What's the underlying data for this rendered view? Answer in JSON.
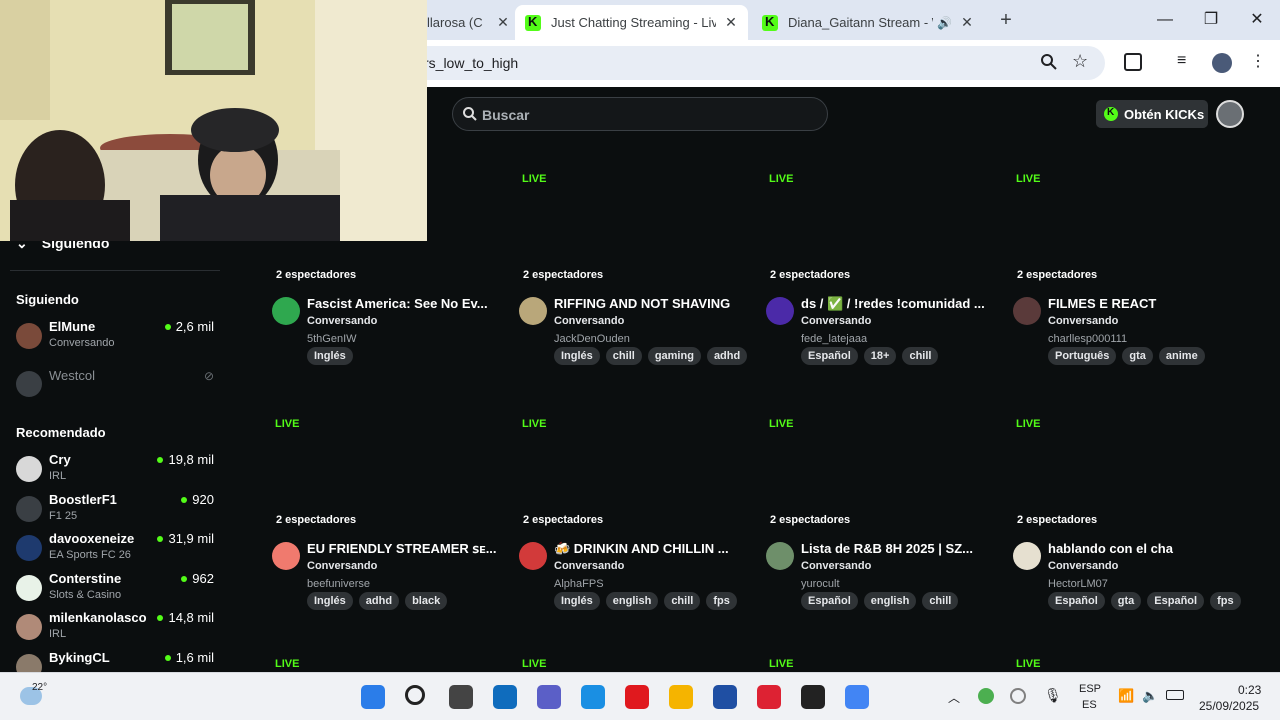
{
  "browser": {
    "tabs": [
      {
        "title": "llarosa (C",
        "active": false
      },
      {
        "title": "Just Chatting Streaming - Live S",
        "active": true
      },
      {
        "title": "Diana_Gaitann Stream - Wa",
        "active": false
      }
    ],
    "url": "rs_low_to_high",
    "new_tab_label": "+",
    "window_controls": {
      "minimize": "—",
      "restore": "❐",
      "close": "✕"
    }
  },
  "header": {
    "search_placeholder": "Buscar",
    "kicks_button": "Obtén KICKs"
  },
  "sidebar": {
    "following_toggle": "Siguiendo",
    "following_title": "Siguiendo",
    "following": [
      {
        "name": "ElMune",
        "category": "Conversando",
        "viewers": "2,6 mil",
        "live": true
      },
      {
        "name": "Westcol",
        "category": "",
        "viewers": "",
        "live": false
      }
    ],
    "recommended_title": "Recomendado",
    "recommended": [
      {
        "name": "Cry",
        "category": "IRL",
        "viewers": "19,8 mil"
      },
      {
        "name": "BoostlerF1",
        "category": "F1 25",
        "viewers": "920"
      },
      {
        "name": "davooxeneize",
        "category": "EA Sports FC 26",
        "viewers": "31,9 mil"
      },
      {
        "name": "Conterstine",
        "category": "Slots & Casino",
        "viewers": "962"
      },
      {
        "name": "milenkanolasco",
        "category": "IRL",
        "viewers": "14,8 mil"
      },
      {
        "name": "BykingCL",
        "category": "",
        "viewers": "1,6 mil"
      }
    ]
  },
  "live_label": "LIVE",
  "streams": [
    {
      "viewers": "2 espectadores",
      "title": "Fascist America: See No Ev...",
      "category": "Conversando",
      "user": "5thGenIW",
      "tags": [
        "Inglés"
      ],
      "avatar_color": "#2fa84f"
    },
    {
      "viewers": "2 espectadores",
      "title": "RIFFING AND NOT SHAVING",
      "category": "Conversando",
      "user": "JackDenOuden",
      "tags": [
        "Inglés",
        "chill",
        "gaming",
        "adhd"
      ],
      "avatar_color": "#b9a77a"
    },
    {
      "viewers": "2 espectadores",
      "title": "ds / ✅ / !redes !comunidad ...",
      "category": "Conversando",
      "user": "fede_latejaaa",
      "tags": [
        "Español",
        "18+",
        "chill"
      ],
      "avatar_color": "#4b2aa8"
    },
    {
      "viewers": "2 espectadores",
      "title": "FILMES E REACT",
      "category": "Conversando",
      "user": "charllesp000111",
      "tags": [
        "Português",
        "gta",
        "anime"
      ],
      "avatar_color": "#5a3a3a"
    },
    {
      "viewers": "2 espectadores",
      "title": "EU FRIENDLY STREAMER ꜱᴇ...",
      "category": "Conversando",
      "user": "beefuniverse",
      "tags": [
        "Inglés",
        "adhd",
        "black"
      ],
      "avatar_color": "#f07a6e"
    },
    {
      "viewers": "2 espectadores",
      "title": "🍻 DRINKIN AND CHILLIN ...",
      "category": "Conversando",
      "user": "AlphaFPS",
      "tags": [
        "Inglés",
        "english",
        "chill",
        "fps"
      ],
      "avatar_color": "#d23a3a"
    },
    {
      "viewers": "2 espectadores",
      "title": "Lista de R&B 8H 2025 | SZ...",
      "category": "Conversando",
      "user": "yurocult",
      "tags": [
        "Español",
        "english",
        "chill"
      ],
      "avatar_color": "#6e8f6a"
    },
    {
      "viewers": "2 espectadores",
      "title": "hablando con el cha",
      "category": "Conversando",
      "user": "HectorLM07",
      "tags": [
        "Español",
        "gta",
        "Español",
        "fps"
      ],
      "avatar_color": "#e6e0d0"
    }
  ],
  "taskbar": {
    "weather_temp": "22°",
    "lang_top": "ESP",
    "lang_bottom": "ES",
    "time": "0:23",
    "date": "25/09/2025",
    "app_icons": [
      "start-icon",
      "search-icon",
      "task-view-icon",
      "outlook-icon",
      "teams-icon",
      "edge-icon",
      "opera-icon",
      "file-explorer-icon",
      "l-app-icon",
      "wps-icon",
      "obs-icon",
      "chrome-icon"
    ]
  },
  "colors": {
    "accent": "#53fc18",
    "bg": "#0b0e0f",
    "tag_bg": "#2f3336"
  }
}
